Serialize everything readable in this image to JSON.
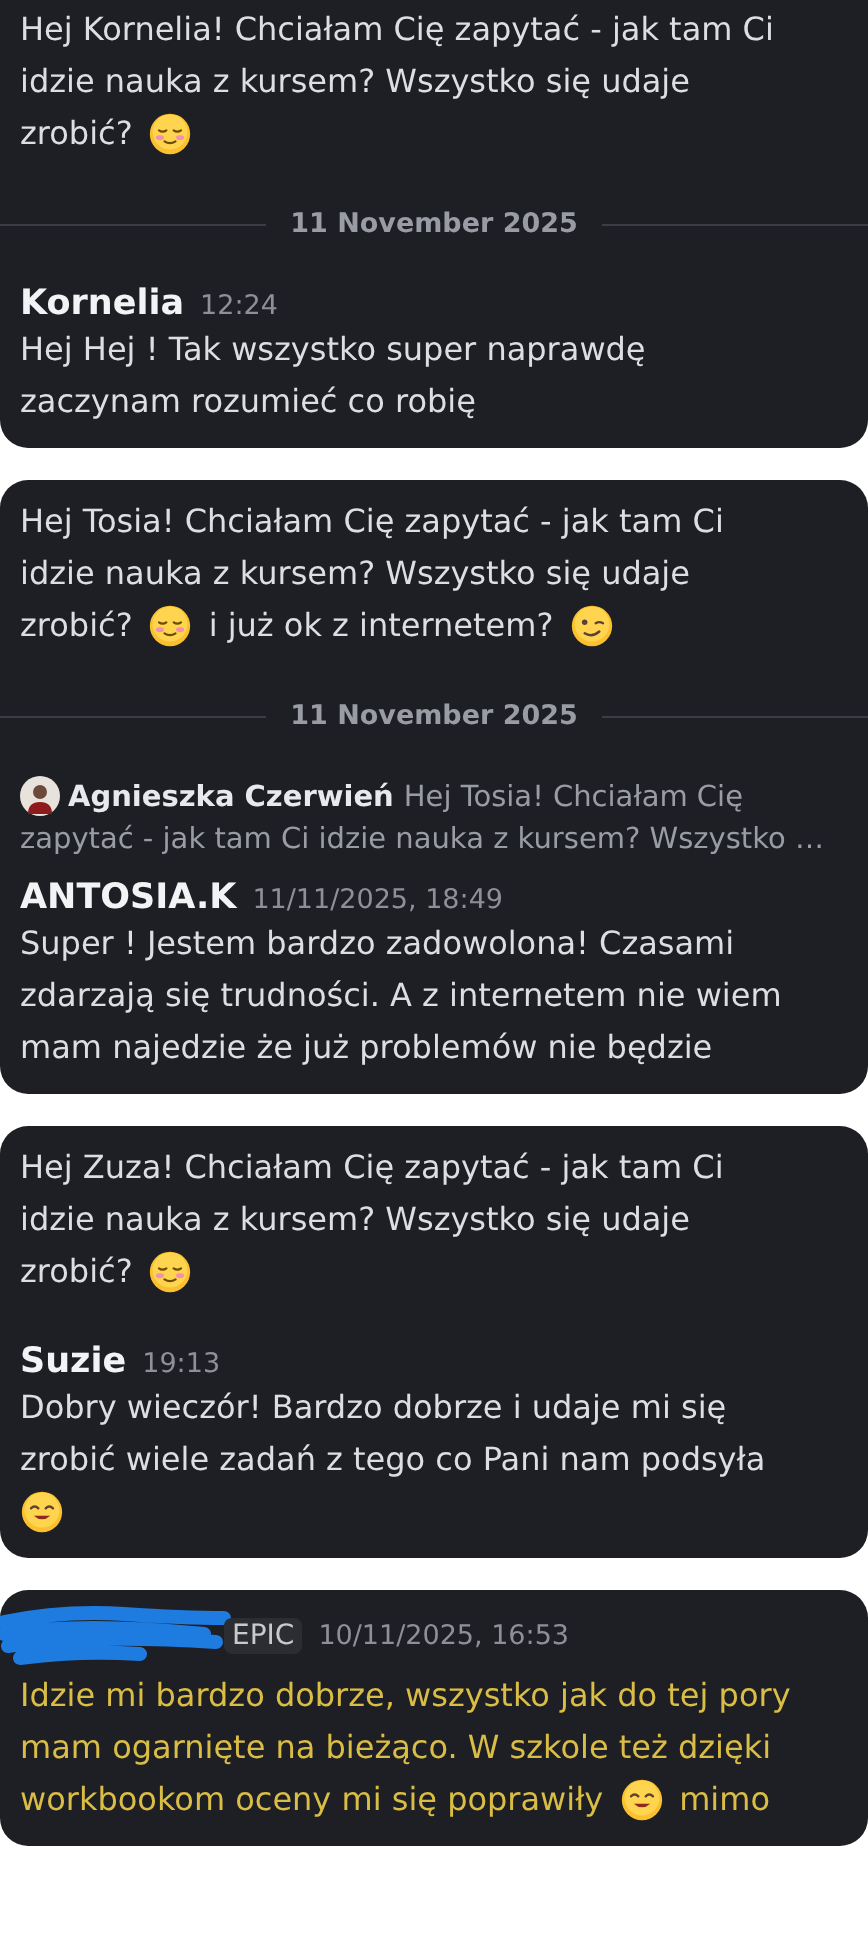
{
  "cards": [
    {
      "cut_top": true,
      "items": [
        {
          "kind": "message",
          "lines": [
            [
              {
                "kind": "text",
                "text": "Hej Kornelia! Chciałam Cię zapytać - jak tam Ci"
              }
            ],
            [
              {
                "kind": "text",
                "text": "idzie nauka z kursem? Wszystko się udaje"
              }
            ],
            [
              {
                "kind": "text",
                "text": "zrobić?"
              },
              {
                "kind": "blush-emoji"
              }
            ]
          ]
        },
        {
          "kind": "divider",
          "label": "11 November 2025"
        },
        {
          "kind": "author",
          "name": "Kornelia",
          "time": "12:24"
        },
        {
          "kind": "message",
          "lines": [
            [
              {
                "kind": "text",
                "text": "Hej Hej ! Tak wszystko super naprawdę"
              }
            ],
            [
              {
                "kind": "text",
                "text": "zaczynam rozumieć co robię"
              }
            ]
          ]
        }
      ]
    },
    {
      "cut_top": false,
      "items": [
        {
          "kind": "message",
          "lines": [
            [
              {
                "kind": "text",
                "text": "Hej Tosia! Chciałam Cię zapytać - jak tam Ci"
              }
            ],
            [
              {
                "kind": "text",
                "text": "idzie nauka z kursem? Wszystko się udaje"
              }
            ],
            [
              {
                "kind": "text",
                "text": "zrobić?"
              },
              {
                "kind": "blush-emoji"
              },
              {
                "kind": "text",
                "text": "i już ok z internetem?"
              },
              {
                "kind": "wink-emoji"
              }
            ]
          ]
        },
        {
          "kind": "divider",
          "label": "11 November 2025"
        },
        {
          "kind": "reply",
          "name": "Agnieszka Czerwień",
          "preview_lines": [
            "Hej Tosia! Chciałam Cię",
            "zapytać - jak tam Ci idzie nauka z kursem? Wszystko …"
          ]
        },
        {
          "kind": "author",
          "name": "ANTOSIA.K",
          "time": "11/11/2025, 18:49"
        },
        {
          "kind": "message",
          "lines": [
            [
              {
                "kind": "text",
                "text": "Super ! Jestem bardzo zadowolona! Czasami"
              }
            ],
            [
              {
                "kind": "text",
                "text": "zdarzają się  trudności. A z internetem nie wiem"
              }
            ],
            [
              {
                "kind": "text",
                "text": "mam najedzie że już problemów nie będzie"
              }
            ]
          ]
        }
      ]
    },
    {
      "cut_top": false,
      "items": [
        {
          "kind": "message",
          "lines": [
            [
              {
                "kind": "text",
                "text": "Hej Zuza! Chciałam Cię zapytać - jak tam Ci"
              }
            ],
            [
              {
                "kind": "text",
                "text": "idzie nauka z kursem? Wszystko się udaje"
              }
            ],
            [
              {
                "kind": "text",
                "text": "zrobić?"
              },
              {
                "kind": "blush-emoji"
              }
            ]
          ]
        },
        {
          "kind": "author",
          "name": "Suzie",
          "time": "19:13"
        },
        {
          "kind": "message",
          "lines": [
            [
              {
                "kind": "text",
                "text": "Dobry wieczór! Bardzo dobrze i udaje mi się"
              }
            ],
            [
              {
                "kind": "text",
                "text": "zrobić wiele zadań z tego co Pani nam podsyła"
              }
            ],
            [
              {
                "kind": "smile-emoji"
              }
            ]
          ]
        }
      ]
    },
    {
      "cut_top": false,
      "items": [
        {
          "kind": "redacted-author",
          "tag": "EPIC",
          "time": "10/11/2025, 16:53"
        },
        {
          "kind": "message",
          "highlighted": true,
          "lines": [
            [
              {
                "kind": "text",
                "text": "Idzie mi bardzo dobrze, wszystko jak do tej pory"
              }
            ],
            [
              {
                "kind": "text",
                "text": "mam ogarnięte na bieżąco. W szkole też dzięki"
              }
            ],
            [
              {
                "kind": "text",
                "text": "workbookom oceny mi się poprawiły"
              },
              {
                "kind": "smile-emoji"
              },
              {
                "kind": "text",
                "text": "mimo"
              }
            ]
          ]
        }
      ]
    }
  ]
}
